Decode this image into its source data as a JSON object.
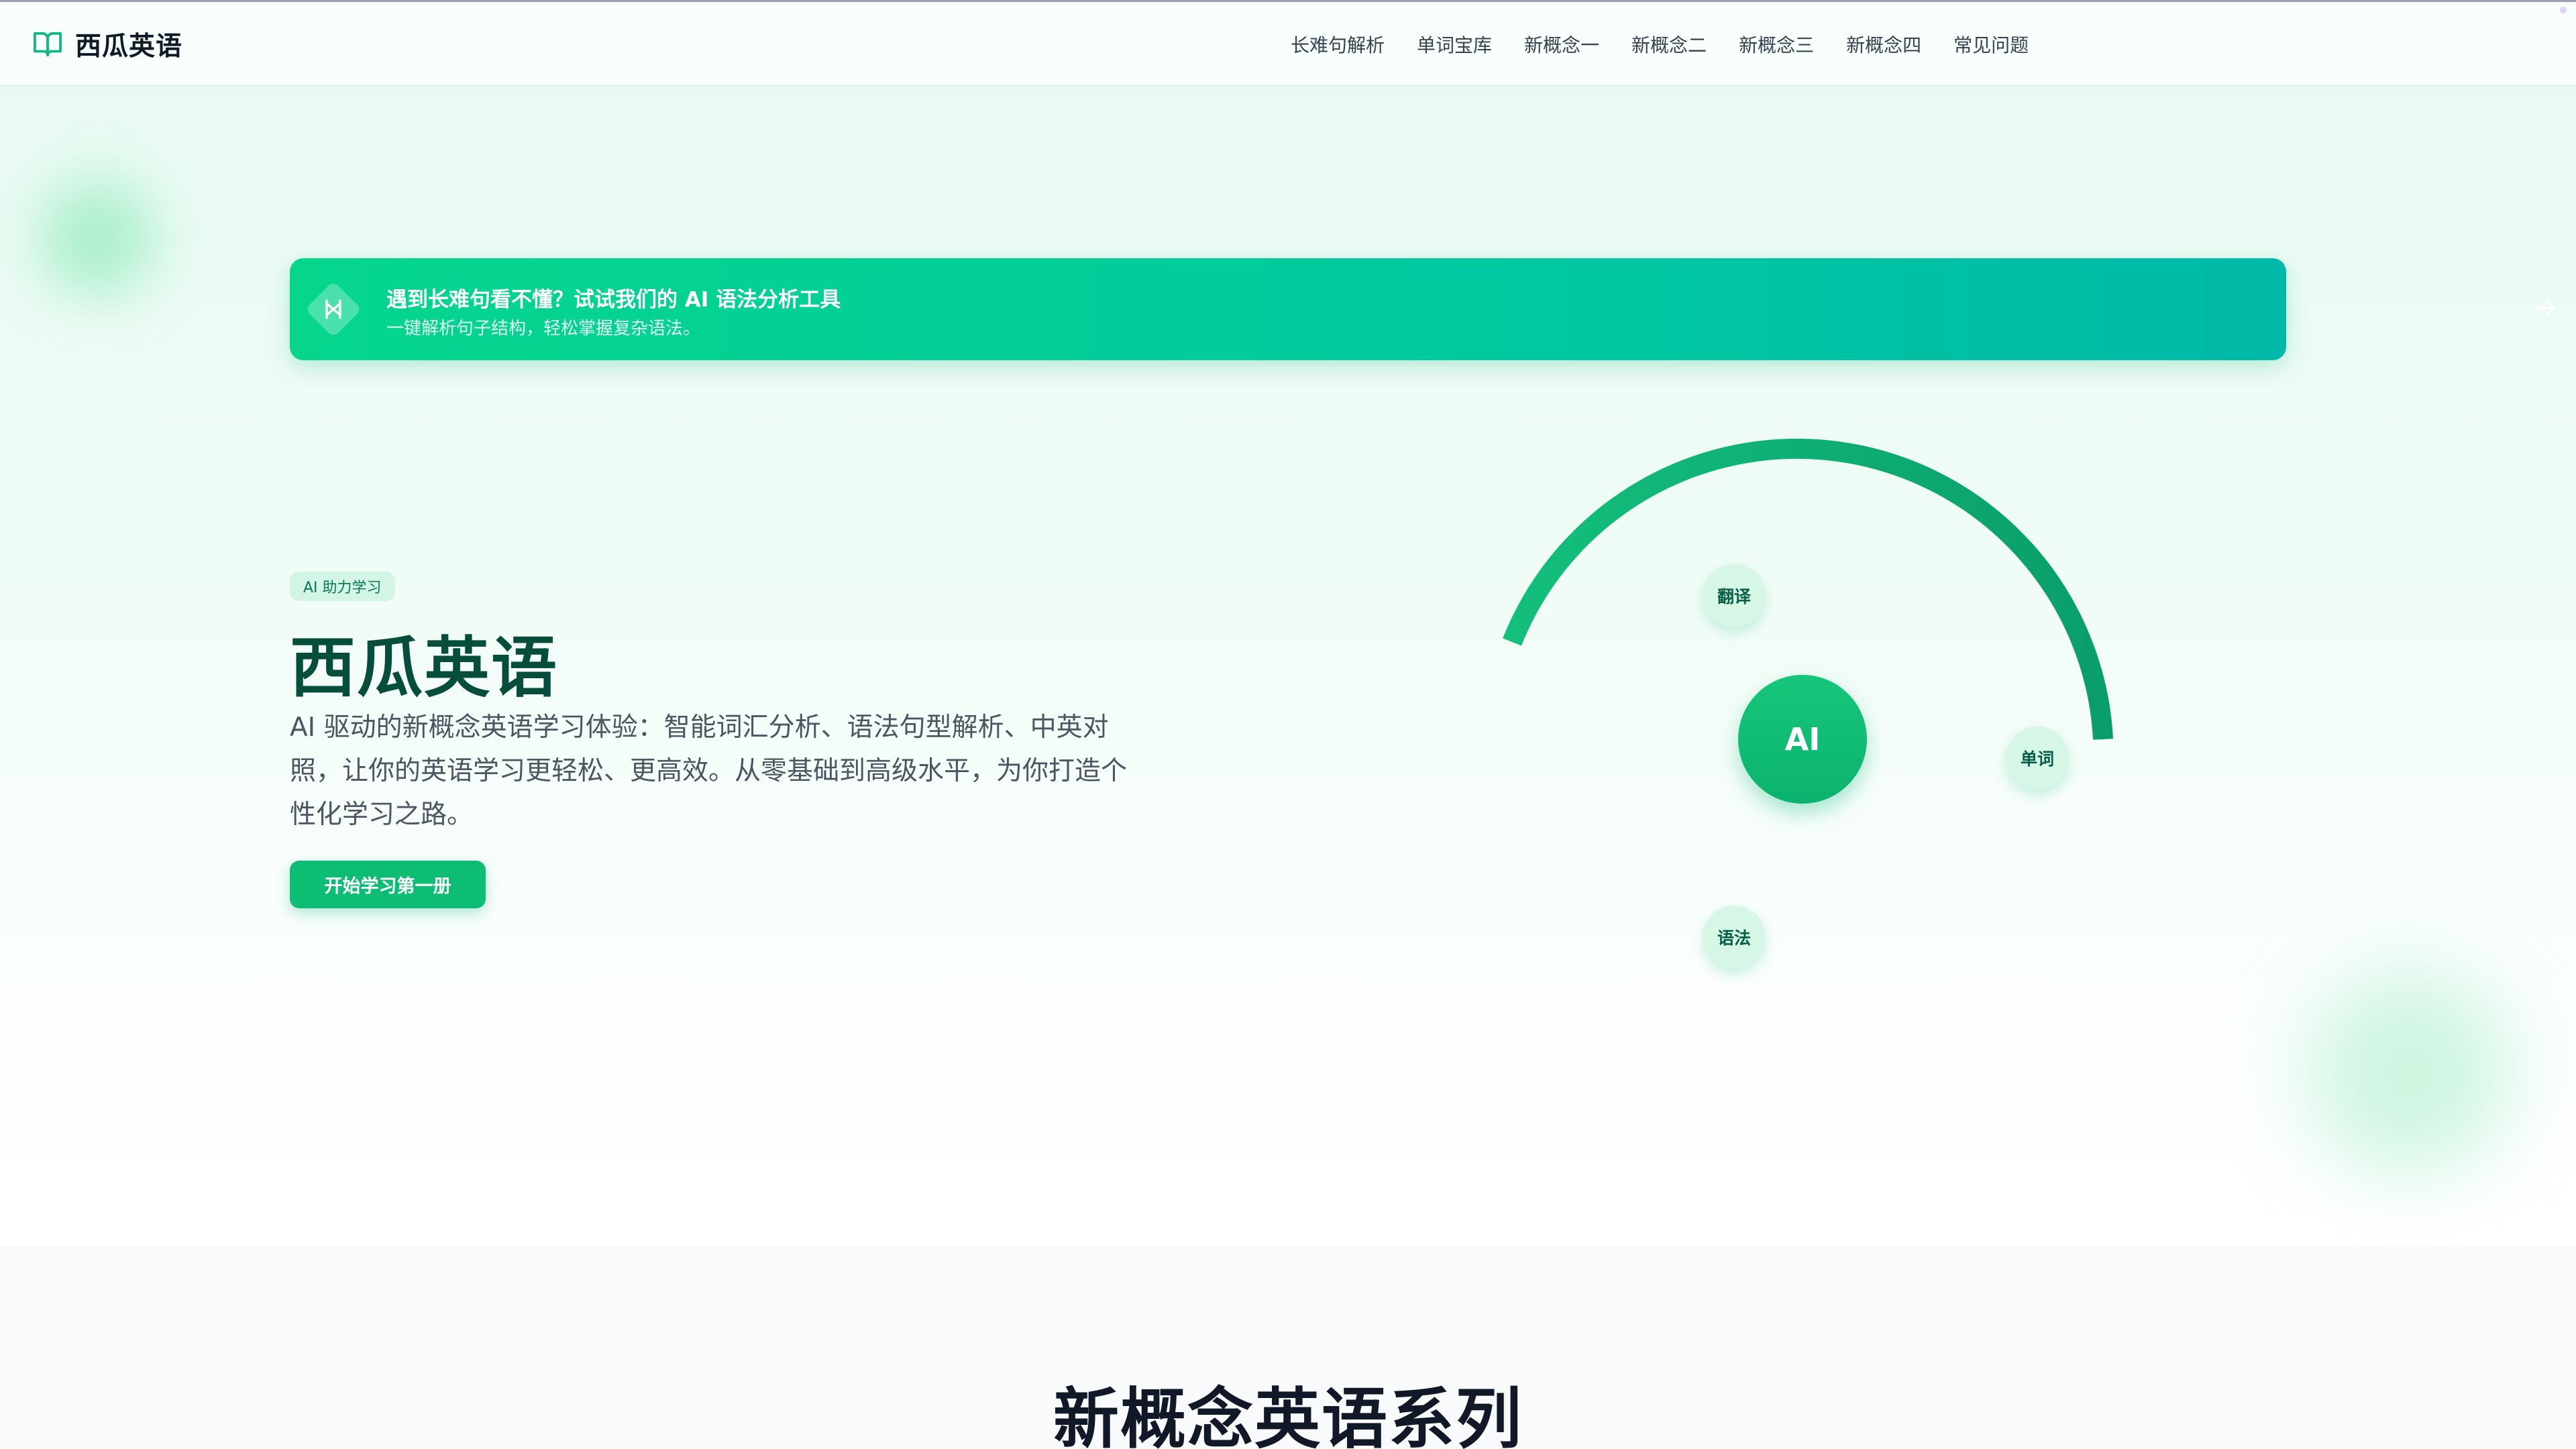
{
  "brand": {
    "name": "西瓜英语",
    "icon": "book-open-icon"
  },
  "nav": {
    "items": [
      {
        "label": "长难句解析"
      },
      {
        "label": "单词宝库"
      },
      {
        "label": "新概念一"
      },
      {
        "label": "新概念二"
      },
      {
        "label": "新概念三"
      },
      {
        "label": "新概念四"
      },
      {
        "label": "常见问题"
      }
    ]
  },
  "banner": {
    "icon": "split-arrows-icon",
    "title": "遇到长难句看不懂？试试我们的 AI 语法分析工具",
    "subtitle": "一键解析句子结构，轻松掌握复杂语法。",
    "arrow_icon": "arrow-right-icon"
  },
  "hero": {
    "badge": "AI 助力学习",
    "title": "西瓜英语",
    "description": "AI 驱动的新概念英语学习体验：智能词汇分析、语法句型解析、中英对照，让你的英语学习更轻松、更高效。从零基础到高级水平，为你打造个性化学习之路。",
    "cta_label": "开始学习第一册"
  },
  "visual": {
    "center_label": "AI",
    "chips": {
      "translate": "翻译",
      "words": "单词",
      "grammar": "语法"
    }
  },
  "series": {
    "title": "新概念英语系列"
  },
  "colors": {
    "primary": "#10b981",
    "dark_green": "#064e3b",
    "banner_start": "#05d68c",
    "banner_end": "#00b9a8"
  }
}
